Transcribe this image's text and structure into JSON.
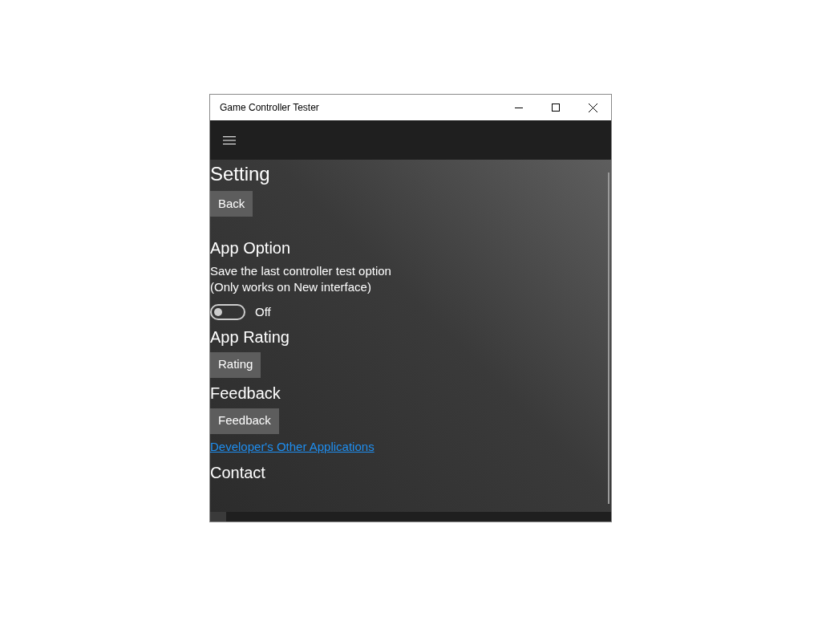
{
  "window": {
    "title": "Game Controller Tester"
  },
  "content": [
    {
      "kind": "page_title",
      "text": "Setting"
    },
    {
      "kind": "button",
      "label": "Back"
    },
    {
      "kind": "heading",
      "text": "App Option"
    },
    {
      "kind": "text",
      "lines": [
        "Save the last controller test option",
        "(Only works on New interface)"
      ]
    },
    {
      "kind": "toggle",
      "on": false,
      "label": "Off"
    },
    {
      "kind": "heading",
      "text": "App Rating"
    },
    {
      "kind": "button",
      "label": "Rating"
    },
    {
      "kind": "heading",
      "text": "Feedback"
    },
    {
      "kind": "button",
      "label": "Feedback"
    },
    {
      "kind": "link",
      "text": "Developer's Other Applications"
    },
    {
      "kind": "heading",
      "text": "Contact"
    }
  ]
}
